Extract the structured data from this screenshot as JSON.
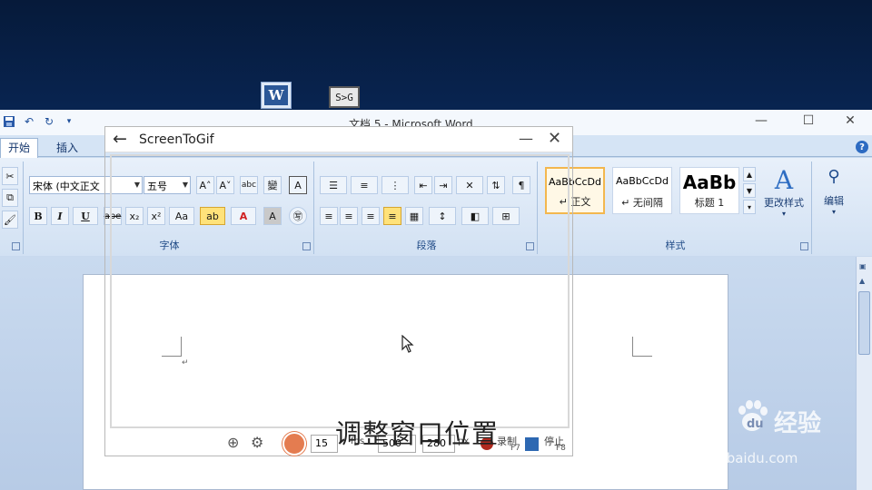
{
  "desktop": {
    "icons": [
      {
        "name": "word-icon",
        "glyph": "W"
      },
      {
        "name": "screentogif-icon",
        "glyph": "S>G"
      }
    ]
  },
  "word": {
    "window_title": "文档 5 - Microsoft Word",
    "tabs": [
      {
        "label": "开始",
        "active": true
      },
      {
        "label": "插入",
        "active": false
      }
    ],
    "font_group": {
      "label": "字体",
      "font_name": "宋体 (中文正文",
      "font_size": "五号",
      "buttons": [
        "B",
        "I",
        "U",
        "abe",
        "x₂",
        "x²",
        "Aa",
        "ab",
        "A",
        "A",
        "㊢"
      ],
      "top_buttons": [
        "A˄",
        "A˅",
        "abc",
        "變",
        "A"
      ]
    },
    "paragraph_group": {
      "label": "段落"
    },
    "styles_group": {
      "label": "样式",
      "styles": [
        {
          "preview": "AaBbCcDd",
          "name": "↵ 正文",
          "selected": true
        },
        {
          "preview": "AaBbCcDd",
          "name": "↵ 无间隔",
          "selected": false
        },
        {
          "preview": "AaBb",
          "name": "标题 1",
          "selected": false
        }
      ],
      "change_styles_label": "更改样式"
    },
    "editing_group": {
      "label": "编辑"
    },
    "document": {
      "paragraph_mark": "↵"
    }
  },
  "screentogif": {
    "title": "ScreenToGif",
    "fps_value": "15",
    "fps_unit": "fps",
    "width_value": "500",
    "height_value": "280",
    "size_unit": "px",
    "record_label": "录制",
    "record_key": "F7",
    "stop_label": "停止",
    "stop_key": "F8",
    "caption": "调整窗口位置"
  },
  "watermark": {
    "brand": "Bai",
    "brand_cn": "经验",
    "url": "jingyan.baidu.com"
  },
  "colors": {
    "desktop": "#0a2c62",
    "ribbon": "#d2e1f3",
    "record": "#b02a1f",
    "stop": "#2d68b2",
    "selected_style": "#f3b74e"
  }
}
